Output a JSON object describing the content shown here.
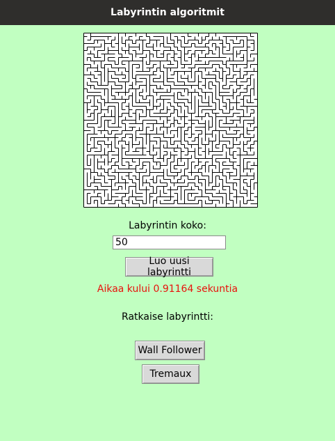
{
  "window": {
    "title": "Labyrintin algoritmit"
  },
  "maze": {
    "grid_size": 50
  },
  "size": {
    "label": "Labyrintin koko:",
    "value": "50"
  },
  "buttons": {
    "new_maze": "Luo uusi labyrintti",
    "wall_follower": "Wall Follower",
    "tremaux": "Tremaux"
  },
  "status": {
    "time_text": "Aikaa kului 0.91164 sekuntia"
  },
  "solve": {
    "label": "Ratkaise labyrintti:"
  },
  "colors": {
    "background": "#c1ffc1",
    "titlebar": "#2f2e2c",
    "status_text": "#e8120c",
    "button": "#d9d9d9"
  }
}
